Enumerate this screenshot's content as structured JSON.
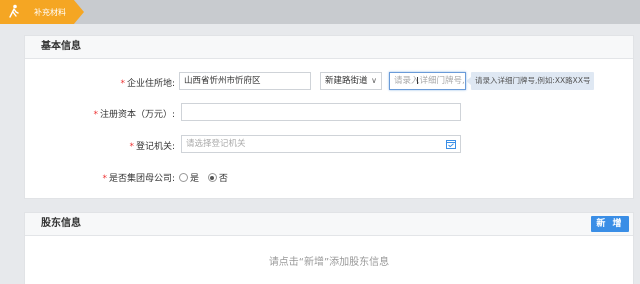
{
  "step": {
    "label": "补充材料"
  },
  "basic": {
    "title": "基本信息",
    "address": {
      "label": "企业住所地:",
      "region_value": "山西省忻州市忻府区",
      "street_value": "新建路街道",
      "detail_placeholder": "请录入详细门牌号,例",
      "tip": "请录入详细门牌号,例如:XX路XX号"
    },
    "capital": {
      "label": "注册资本（万元）:",
      "value": ""
    },
    "authority": {
      "label": "登记机关:",
      "placeholder": "请选择登记机关"
    },
    "group_parent": {
      "label": "是否集团母公司:",
      "options": [
        "是",
        "否"
      ],
      "selected": "否"
    }
  },
  "shareholder": {
    "title": "股东信息",
    "add_button": "新 增",
    "empty_message": "请点击“新增”添加股东信息"
  },
  "colors": {
    "accent": "#f5a623",
    "primary": "#3a8ee6",
    "required": "#e33"
  },
  "icons": [
    "step-person-icon",
    "chevron-down-icon",
    "calendar-icon",
    "text-cursor-icon"
  ]
}
